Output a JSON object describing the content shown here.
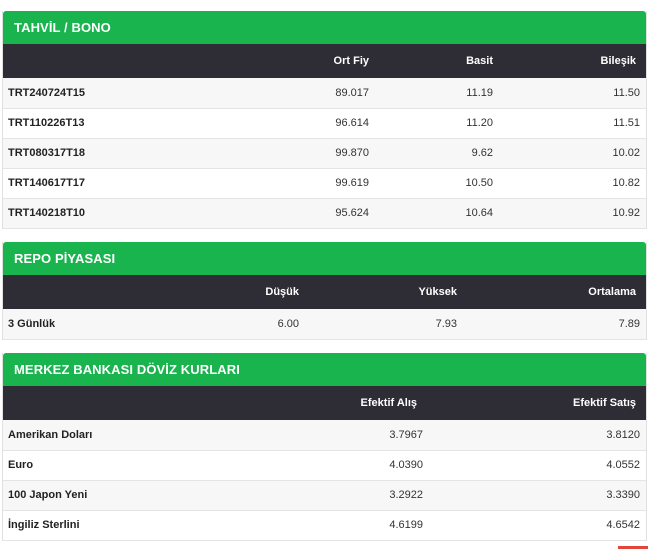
{
  "tahvil": {
    "title": "TAHVİL / BONO",
    "headers": [
      "",
      "Ort Fiy",
      "Basit",
      "Bileşik"
    ],
    "rows": [
      {
        "name": "TRT240724T15",
        "ort": "89.017",
        "basit": "11.19",
        "bilesik": "11.50"
      },
      {
        "name": "TRT110226T13",
        "ort": "96.614",
        "basit": "11.20",
        "bilesik": "11.51"
      },
      {
        "name": "TRT080317T18",
        "ort": "99.870",
        "basit": "9.62",
        "bilesik": "10.02"
      },
      {
        "name": "TRT140617T17",
        "ort": "99.619",
        "basit": "10.50",
        "bilesik": "10.82"
      },
      {
        "name": "TRT140218T10",
        "ort": "95.624",
        "basit": "10.64",
        "bilesik": "10.92"
      }
    ]
  },
  "repo": {
    "title": "REPO PİYASASI",
    "headers": [
      "",
      "Düşük",
      "Yüksek",
      "Ortalama"
    ],
    "rows": [
      {
        "name": "3 Günlük",
        "dusuk": "6.00",
        "yuksek": "7.93",
        "ortalama": "7.89"
      }
    ]
  },
  "doviz": {
    "title": "MERKEZ BANKASI DÖVİZ KURLARI",
    "headers": [
      "",
      "Efektif Alış",
      "Efektif Satış"
    ],
    "rows": [
      {
        "name": "Amerikan Doları",
        "alis": "3.7967",
        "satis": "3.8120"
      },
      {
        "name": "Euro",
        "alis": "4.0390",
        "satis": "4.0552"
      },
      {
        "name": "100 Japon Yeni",
        "alis": "3.2922",
        "satis": "3.3390"
      },
      {
        "name": "İngiliz Sterlini",
        "alis": "4.6199",
        "satis": "4.6542"
      }
    ]
  },
  "colors": {
    "header_green": "#1ab44f",
    "table_head_dark": "#2e2d35",
    "accent_red": "#e0463a"
  }
}
